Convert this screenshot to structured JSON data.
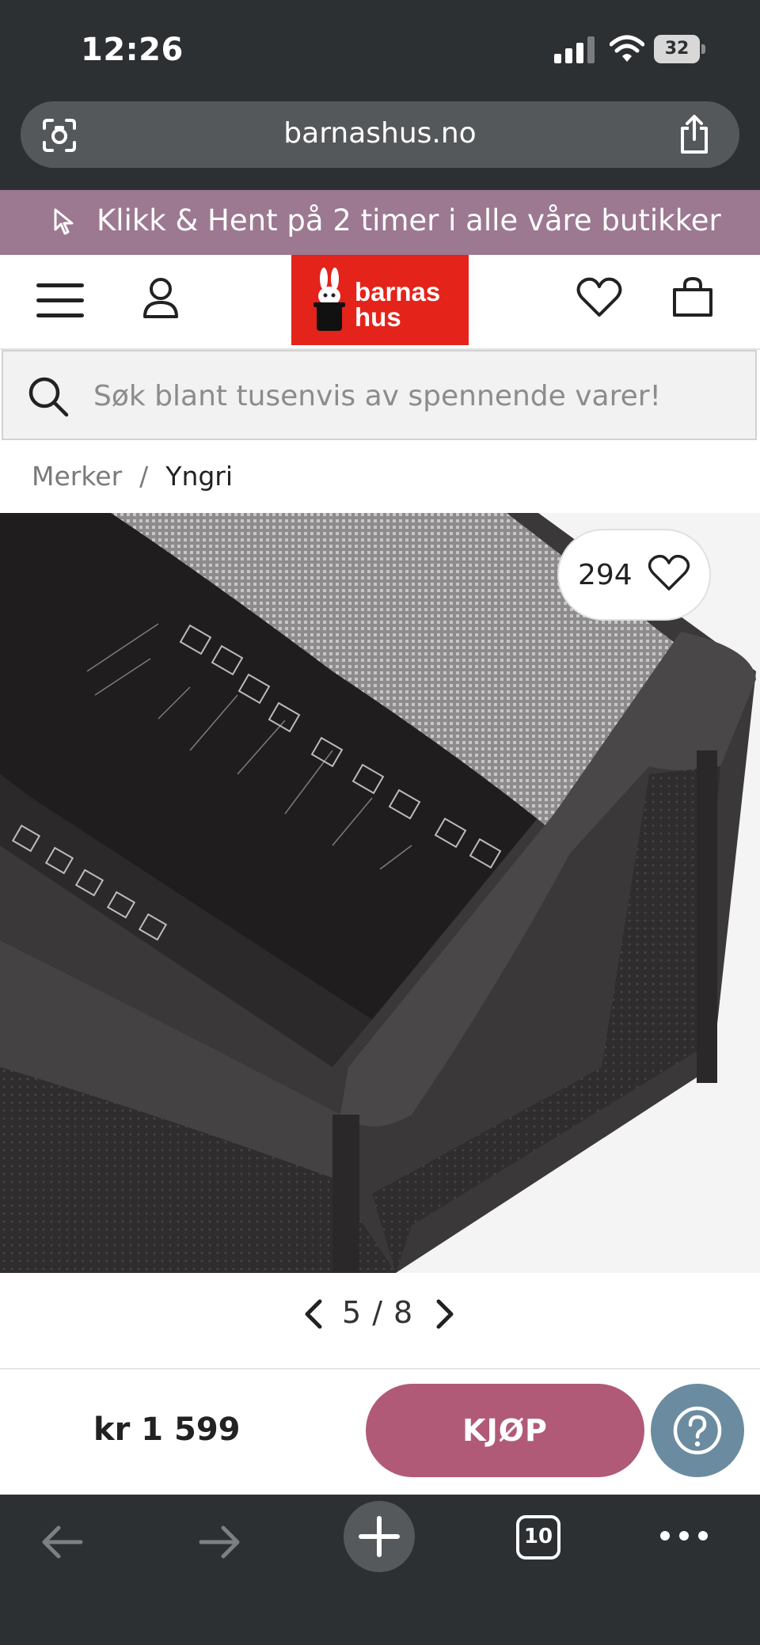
{
  "status_bar": {
    "time": "12:26",
    "battery": "32"
  },
  "browser": {
    "url": "barnashus.no",
    "tab_count": "10"
  },
  "promo": {
    "text": "Klikk & Hent på 2 timer i alle våre butikker",
    "icon": "cursor-icon"
  },
  "header": {
    "logo_line1": "barnas",
    "logo_line2": "hus",
    "brand_color": "#e4231a"
  },
  "search": {
    "placeholder": "Søk blant tusenvis av spennende varer!"
  },
  "breadcrumb": {
    "items": [
      "Merker",
      "Yngri"
    ],
    "separator": "/"
  },
  "product": {
    "likes": "294",
    "gallery_current": "5",
    "gallery_separator": "/",
    "gallery_total": "8"
  },
  "buy_bar": {
    "price": "kr 1 599",
    "buy_label": "KJØP",
    "accent": "#b15a78"
  },
  "colors": {
    "browser_chrome": "#2d3033",
    "promo_bg": "#9c7891",
    "help_bg": "#6b8ba0"
  }
}
